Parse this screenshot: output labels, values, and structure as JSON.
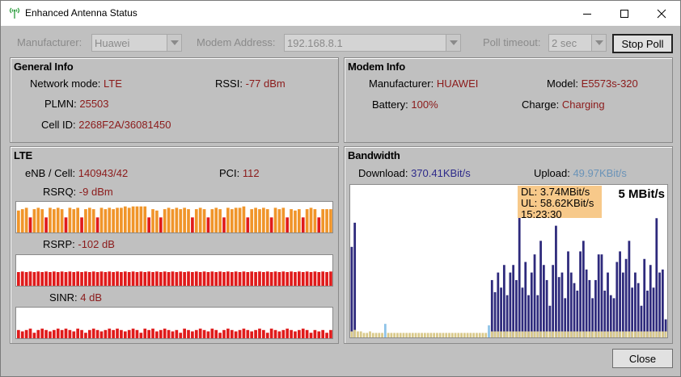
{
  "window": {
    "title": "Enhanced Antenna Status"
  },
  "toolbar": {
    "manufacturer_label": "Manufacturer:",
    "manufacturer_value": "Huawei",
    "modem_address_label": "Modem Address:",
    "modem_address_value": "192.168.8.1",
    "poll_timeout_label": "Poll timeout:",
    "poll_timeout_value": "2 sec",
    "stop_poll_label": "Stop Poll"
  },
  "general_info": {
    "title": "General Info",
    "network_mode_label": "Network mode:",
    "network_mode_value": "LTE",
    "rssi_label": "RSSI:",
    "rssi_value": "-77 dBm",
    "plmn_label": "PLMN:",
    "plmn_value": "25503",
    "cell_id_label": "Cell ID:",
    "cell_id_value": "2268F2A/36081450"
  },
  "modem_info": {
    "title": "Modem Info",
    "manufacturer_label": "Manufacturer:",
    "manufacturer_value": "HUAWEI",
    "model_label": "Model:",
    "model_value": "E5573s-320",
    "battery_label": "Battery:",
    "battery_value": "100%",
    "charge_label": "Charge:",
    "charge_value": "Charging"
  },
  "lte": {
    "title": "LTE",
    "enb_label": "eNB / Cell:",
    "enb_value": "140943/42",
    "pci_label": "PCI:",
    "pci_value": "112",
    "rsrq_label": "RSRQ:",
    "rsrq_value": "-9 dBm",
    "rsrp_label": "RSRP:",
    "rsrp_value": "-102 dB",
    "sinr_label": "SINR:",
    "sinr_value": "4 dB",
    "rsrq_history": [
      0.8,
      0.85,
      0.9,
      0.55,
      0.85,
      0.9,
      0.85,
      0.55,
      0.9,
      0.85,
      0.9,
      0.85,
      0.55,
      0.9,
      0.85,
      0.9,
      0.55,
      0.85,
      0.9,
      0.85,
      0.55,
      0.9,
      0.85,
      0.9,
      0.85,
      0.9,
      0.9,
      0.95,
      0.9,
      0.95,
      0.95,
      0.95,
      0.95,
      0.55,
      0.85,
      0.8,
      0.55,
      0.85,
      0.9,
      0.85,
      0.9,
      0.85,
      0.9,
      0.85,
      0.55,
      0.85,
      0.9,
      0.85,
      0.55,
      0.85,
      0.9,
      0.85,
      0.55,
      0.9,
      0.85,
      0.9,
      0.9,
      0.95,
      0.55,
      0.85,
      0.9,
      0.85,
      0.9,
      0.85,
      0.55,
      0.9,
      0.85,
      0.9,
      0.55,
      0.85,
      0.8,
      0.85,
      0.55,
      0.85,
      0.9,
      0.85,
      0.55,
      0.85,
      0.85,
      0.85
    ],
    "rsrp_history": [
      0.5,
      0.52,
      0.5,
      0.52,
      0.5,
      0.52,
      0.5,
      0.52,
      0.5,
      0.52,
      0.5,
      0.52,
      0.5,
      0.52,
      0.5,
      0.52,
      0.5,
      0.52,
      0.5,
      0.52,
      0.5,
      0.52,
      0.5,
      0.52,
      0.5,
      0.52,
      0.5,
      0.52,
      0.5,
      0.52,
      0.5,
      0.52,
      0.5,
      0.52,
      0.5,
      0.52,
      0.5,
      0.52,
      0.5,
      0.52,
      0.5,
      0.52,
      0.5,
      0.52,
      0.5,
      0.52,
      0.5,
      0.52,
      0.5,
      0.52,
      0.5,
      0.52,
      0.5,
      0.52,
      0.5,
      0.52,
      0.5,
      0.52,
      0.5,
      0.52,
      0.5,
      0.52,
      0.5,
      0.52,
      0.5,
      0.52,
      0.5,
      0.52,
      0.5,
      0.52,
      0.5,
      0.52,
      0.5,
      0.52,
      0.5,
      0.52,
      0.5,
      0.52,
      0.5,
      0.52
    ],
    "sinr_history": [
      0.3,
      0.25,
      0.3,
      0.35,
      0.2,
      0.3,
      0.35,
      0.3,
      0.25,
      0.3,
      0.35,
      0.3,
      0.35,
      0.3,
      0.25,
      0.35,
      0.3,
      0.2,
      0.3,
      0.35,
      0.3,
      0.25,
      0.3,
      0.35,
      0.3,
      0.35,
      0.3,
      0.25,
      0.3,
      0.35,
      0.3,
      0.2,
      0.35,
      0.3,
      0.35,
      0.25,
      0.3,
      0.35,
      0.3,
      0.25,
      0.3,
      0.2,
      0.35,
      0.3,
      0.25,
      0.3,
      0.35,
      0.3,
      0.25,
      0.35,
      0.3,
      0.2,
      0.3,
      0.35,
      0.3,
      0.25,
      0.3,
      0.35,
      0.3,
      0.25,
      0.3,
      0.35,
      0.3,
      0.2,
      0.35,
      0.3,
      0.25,
      0.3,
      0.35,
      0.3,
      0.25,
      0.3,
      0.35,
      0.3,
      0.2,
      0.3,
      0.25,
      0.3,
      0.2,
      0.3
    ]
  },
  "bandwidth": {
    "title": "Bandwidth",
    "download_label": "Download:",
    "download_value": "370.41KBit/s",
    "upload_label": "Upload:",
    "upload_value": "49.97KBit/s",
    "scale_label": "5 MBit/s",
    "tooltip": {
      "dl": "DL: 3.74MBit/s",
      "ul": "UL: 58.62KBit/s",
      "time": "15:23:30"
    },
    "colors": {
      "download": "#2e2a7c",
      "upload": "#d9c98a",
      "upload_highlight": "#8ec3e8",
      "tooltip_bg": "#f7c98a"
    },
    "download_history": [
      0.6,
      0.76,
      0,
      0,
      0,
      0,
      0,
      0,
      0,
      0,
      0,
      0,
      0,
      0,
      0,
      0,
      0,
      0,
      0,
      0,
      0,
      0,
      0,
      0,
      0,
      0,
      0,
      0,
      0,
      0,
      0,
      0,
      0,
      0,
      0,
      0,
      0,
      0,
      0,
      0,
      0,
      0,
      0,
      0,
      0,
      0,
      0.38,
      0.3,
      0.43,
      0.33,
      0.48,
      0.28,
      0.43,
      0.48,
      0.38,
      0.9,
      0.33,
      0.5,
      0.28,
      0.43,
      0.55,
      0.28,
      0.64,
      0.48,
      0.38,
      0.21,
      0.48,
      0.74,
      0.4,
      0.43,
      0.26,
      0.57,
      0.43,
      0.36,
      0.31,
      0.57,
      0.64,
      0.45,
      0.38,
      0.26,
      0.38,
      0.55,
      0.55,
      0.31,
      0.43,
      0.28,
      0.26,
      0.5,
      0.57,
      0.43,
      0.52,
      0.64,
      0.33,
      0.43,
      0.36,
      0.21,
      0.52,
      0.31,
      0.48,
      0.33,
      0.79,
      0.43,
      0.45,
      0.12
    ],
    "upload_history": [
      0.04,
      0.05,
      0.04,
      0.04,
      0.03,
      0.03,
      0.04,
      0.03,
      0.03,
      0.03,
      0.03,
      0.09,
      0.03,
      0.03,
      0.03,
      0.03,
      0.03,
      0.03,
      0.03,
      0.03,
      0.03,
      0.03,
      0.03,
      0.03,
      0.03,
      0.03,
      0.03,
      0.03,
      0.03,
      0.03,
      0.03,
      0.03,
      0.03,
      0.03,
      0.03,
      0.03,
      0.03,
      0.03,
      0.03,
      0.03,
      0.03,
      0.03,
      0.03,
      0.03,
      0.03,
      0.08,
      0.04,
      0.04,
      0.04,
      0.04,
      0.04,
      0.04,
      0.04,
      0.04,
      0.04,
      0.04,
      0.04,
      0.04,
      0.04,
      0.04,
      0.04,
      0.04,
      0.04,
      0.04,
      0.04,
      0.04,
      0.04,
      0.04,
      0.04,
      0.04,
      0.04,
      0.04,
      0.04,
      0.04,
      0.04,
      0.04,
      0.04,
      0.04,
      0.04,
      0.04,
      0.04,
      0.04,
      0.04,
      0.04,
      0.04,
      0.04,
      0.04,
      0.04,
      0.04,
      0.04,
      0.04,
      0.04,
      0.04,
      0.04,
      0.04,
      0.04,
      0.04,
      0.04,
      0.04,
      0.04,
      0.04,
      0.04,
      0.04,
      0.04,
      0.04
    ]
  },
  "footer": {
    "close_label": "Close"
  }
}
